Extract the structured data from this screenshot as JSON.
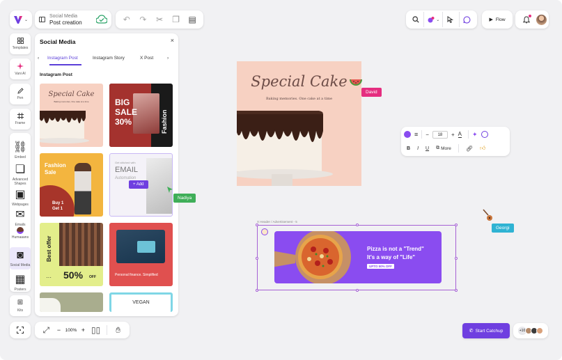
{
  "document": {
    "category": "Social Media",
    "name": "Post creation"
  },
  "toolbar": {
    "flow_label": "Flow"
  },
  "rail": {
    "templates": "Templates",
    "vani_ai": "Vani AI",
    "pen": "Pen",
    "frame": "Frame",
    "embed": "Embed",
    "advanced_shapes": "Advanced Shapes",
    "webpages": "Webpages",
    "emails": "Emails",
    "humaaans": "Humaaans",
    "social_media": "Social Media",
    "posters": "Posters",
    "kits": "Kits"
  },
  "panel": {
    "title": "Social Media",
    "close": "×",
    "tabs": [
      "Instagram Post",
      "Instagram Story",
      "X Post"
    ],
    "section": "Instagram Post",
    "add_label": "+ Add",
    "thumbs": {
      "t1_title": "Special Cake",
      "t1_sub": "Baking memories, One cake at a time",
      "t2_l1": "BIG",
      "t2_l2": "SALE",
      "t2_l3": "30%",
      "t2_side": "Fashion",
      "t3_l1": "Fashion",
      "t3_l2": "Sale",
      "t3_b1": "Buy 1",
      "t3_b2": "Get 1",
      "t4_l1": "Get stitched with",
      "t4_l2": "EMAIL",
      "t4_l3": "Automation",
      "t5_side": "Best offer",
      "t5_pct": "50%",
      "t5_off": "OFF",
      "t6_text": "Personal finance. Simplified",
      "t8_text": "VEGAN"
    }
  },
  "canvas": {
    "cake_title": "Special Cake",
    "cake_tagline": "Baking memories. One cake at a time",
    "banner_breadcrumb": "X Header / Advertisement - 5",
    "banner_line1": "Pizza is not a \"Trend\"",
    "banner_line2": "It's a way of \"Life\"",
    "banner_cta": "UPTO 50% OFF"
  },
  "cursors": {
    "david": "David",
    "nadiya": "Nadiya",
    "georgi": "Georgi"
  },
  "format": {
    "font_size": "18",
    "minus": "−",
    "plus": "+",
    "bold": "B",
    "italic": "I",
    "underline": "U",
    "more": "More"
  },
  "zoom": {
    "level": "100%",
    "minus": "−",
    "plus": "+"
  },
  "collab": {
    "start_catchup": "Start Catchup",
    "extra_count": "+10"
  },
  "colors": {
    "accent": "#6f3fe0",
    "david": "#e52d7f",
    "nadiya": "#3fae58",
    "georgi": "#2fb3d3",
    "text_color_swatch": "#8a4cf0"
  }
}
